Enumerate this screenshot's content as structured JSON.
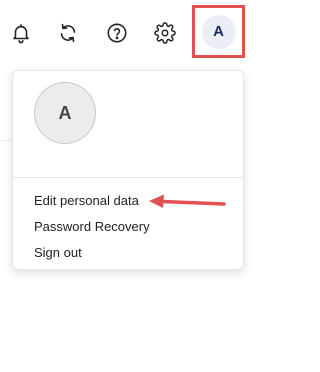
{
  "header": {
    "icons": [
      {
        "name": "bell-icon"
      },
      {
        "name": "sync-icon"
      },
      {
        "name": "help-icon"
      },
      {
        "name": "gear-icon"
      }
    ],
    "avatar_initial": "A",
    "highlight_color": "#e0514f"
  },
  "menu": {
    "avatar_initial": "A",
    "items": [
      {
        "label": "Edit personal data"
      },
      {
        "label": "Password Recovery"
      },
      {
        "label": "Sign out"
      }
    ]
  },
  "annotation": {
    "arrow_color": "#e0514f",
    "points_to": "Edit personal data"
  }
}
